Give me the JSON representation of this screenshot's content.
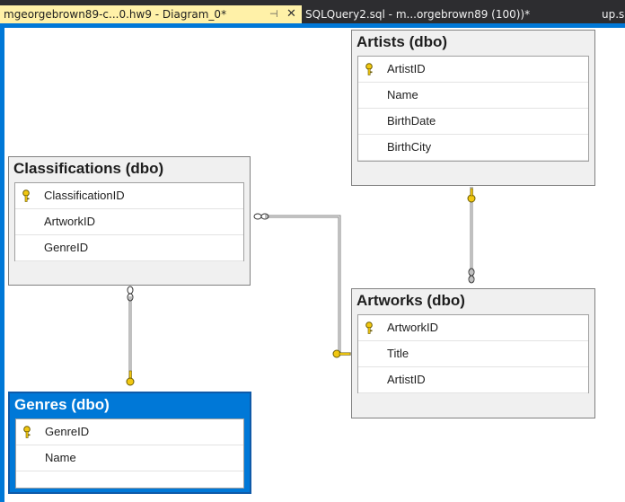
{
  "tabs": {
    "active": "mgeorgebrown89-c...0.hw9 - Diagram_0*",
    "pin_glyph": "⊣",
    "close_glyph": "✕",
    "second": "SQLQuery2.sql - m...orgebrown89 (100))*",
    "third": "up.s"
  },
  "tables": {
    "artists": {
      "title": "Artists (dbo)",
      "columns": [
        "ArtistID",
        "Name",
        "BirthDate",
        "BirthCity"
      ],
      "key_column": "ArtistID"
    },
    "classifications": {
      "title": "Classifications (dbo)",
      "columns": [
        "ClassificationID",
        "ArtworkID",
        "GenreID"
      ],
      "key_column": "ClassificationID"
    },
    "artworks": {
      "title": "Artworks (dbo)",
      "columns": [
        "ArtworkID",
        "Title",
        "ArtistID"
      ],
      "key_column": "ArtworkID"
    },
    "genres": {
      "title": "Genres (dbo)",
      "columns": [
        "GenreID",
        "Name"
      ],
      "key_column": "GenreID",
      "selected": true
    }
  },
  "relationships": [
    {
      "from": "Artworks",
      "to": "Artists",
      "one_end": "Artists",
      "many_end": "Artworks"
    },
    {
      "from": "Classifications",
      "to": "Artworks",
      "one_end": "Artworks",
      "many_end": "Classifications"
    },
    {
      "from": "Classifications",
      "to": "Genres",
      "one_end": "Genres",
      "many_end": "Classifications"
    }
  ],
  "colors": {
    "key_icon": "#f2c811",
    "selection": "#0078d7",
    "tab_active": "#fff1a8"
  }
}
